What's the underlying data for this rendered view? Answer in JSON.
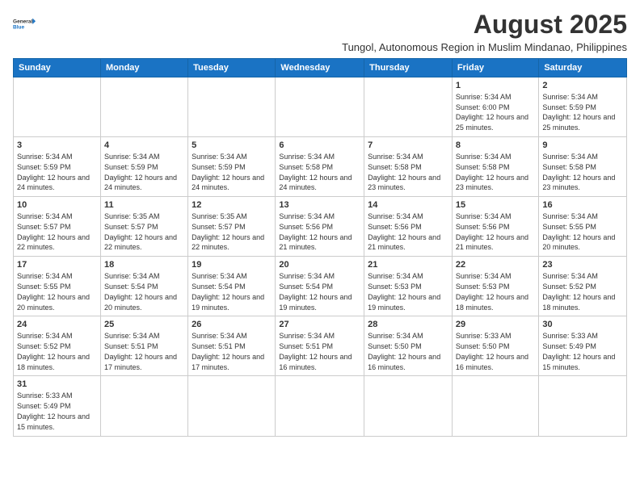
{
  "header": {
    "logo_general": "General",
    "logo_blue": "Blue",
    "main_title": "August 2025",
    "subtitle": "Tungol, Autonomous Region in Muslim Mindanao, Philippines"
  },
  "days_of_week": [
    "Sunday",
    "Monday",
    "Tuesday",
    "Wednesday",
    "Thursday",
    "Friday",
    "Saturday"
  ],
  "weeks": [
    [
      {
        "day": "",
        "info": ""
      },
      {
        "day": "",
        "info": ""
      },
      {
        "day": "",
        "info": ""
      },
      {
        "day": "",
        "info": ""
      },
      {
        "day": "",
        "info": ""
      },
      {
        "day": "1",
        "info": "Sunrise: 5:34 AM\nSunset: 6:00 PM\nDaylight: 12 hours and 25 minutes."
      },
      {
        "day": "2",
        "info": "Sunrise: 5:34 AM\nSunset: 5:59 PM\nDaylight: 12 hours and 25 minutes."
      }
    ],
    [
      {
        "day": "3",
        "info": "Sunrise: 5:34 AM\nSunset: 5:59 PM\nDaylight: 12 hours and 24 minutes."
      },
      {
        "day": "4",
        "info": "Sunrise: 5:34 AM\nSunset: 5:59 PM\nDaylight: 12 hours and 24 minutes."
      },
      {
        "day": "5",
        "info": "Sunrise: 5:34 AM\nSunset: 5:59 PM\nDaylight: 12 hours and 24 minutes."
      },
      {
        "day": "6",
        "info": "Sunrise: 5:34 AM\nSunset: 5:58 PM\nDaylight: 12 hours and 24 minutes."
      },
      {
        "day": "7",
        "info": "Sunrise: 5:34 AM\nSunset: 5:58 PM\nDaylight: 12 hours and 23 minutes."
      },
      {
        "day": "8",
        "info": "Sunrise: 5:34 AM\nSunset: 5:58 PM\nDaylight: 12 hours and 23 minutes."
      },
      {
        "day": "9",
        "info": "Sunrise: 5:34 AM\nSunset: 5:58 PM\nDaylight: 12 hours and 23 minutes."
      }
    ],
    [
      {
        "day": "10",
        "info": "Sunrise: 5:34 AM\nSunset: 5:57 PM\nDaylight: 12 hours and 22 minutes."
      },
      {
        "day": "11",
        "info": "Sunrise: 5:35 AM\nSunset: 5:57 PM\nDaylight: 12 hours and 22 minutes."
      },
      {
        "day": "12",
        "info": "Sunrise: 5:35 AM\nSunset: 5:57 PM\nDaylight: 12 hours and 22 minutes."
      },
      {
        "day": "13",
        "info": "Sunrise: 5:34 AM\nSunset: 5:56 PM\nDaylight: 12 hours and 21 minutes."
      },
      {
        "day": "14",
        "info": "Sunrise: 5:34 AM\nSunset: 5:56 PM\nDaylight: 12 hours and 21 minutes."
      },
      {
        "day": "15",
        "info": "Sunrise: 5:34 AM\nSunset: 5:56 PM\nDaylight: 12 hours and 21 minutes."
      },
      {
        "day": "16",
        "info": "Sunrise: 5:34 AM\nSunset: 5:55 PM\nDaylight: 12 hours and 20 minutes."
      }
    ],
    [
      {
        "day": "17",
        "info": "Sunrise: 5:34 AM\nSunset: 5:55 PM\nDaylight: 12 hours and 20 minutes."
      },
      {
        "day": "18",
        "info": "Sunrise: 5:34 AM\nSunset: 5:54 PM\nDaylight: 12 hours and 20 minutes."
      },
      {
        "day": "19",
        "info": "Sunrise: 5:34 AM\nSunset: 5:54 PM\nDaylight: 12 hours and 19 minutes."
      },
      {
        "day": "20",
        "info": "Sunrise: 5:34 AM\nSunset: 5:54 PM\nDaylight: 12 hours and 19 minutes."
      },
      {
        "day": "21",
        "info": "Sunrise: 5:34 AM\nSunset: 5:53 PM\nDaylight: 12 hours and 19 minutes."
      },
      {
        "day": "22",
        "info": "Sunrise: 5:34 AM\nSunset: 5:53 PM\nDaylight: 12 hours and 18 minutes."
      },
      {
        "day": "23",
        "info": "Sunrise: 5:34 AM\nSunset: 5:52 PM\nDaylight: 12 hours and 18 minutes."
      }
    ],
    [
      {
        "day": "24",
        "info": "Sunrise: 5:34 AM\nSunset: 5:52 PM\nDaylight: 12 hours and 18 minutes."
      },
      {
        "day": "25",
        "info": "Sunrise: 5:34 AM\nSunset: 5:51 PM\nDaylight: 12 hours and 17 minutes."
      },
      {
        "day": "26",
        "info": "Sunrise: 5:34 AM\nSunset: 5:51 PM\nDaylight: 12 hours and 17 minutes."
      },
      {
        "day": "27",
        "info": "Sunrise: 5:34 AM\nSunset: 5:51 PM\nDaylight: 12 hours and 16 minutes."
      },
      {
        "day": "28",
        "info": "Sunrise: 5:34 AM\nSunset: 5:50 PM\nDaylight: 12 hours and 16 minutes."
      },
      {
        "day": "29",
        "info": "Sunrise: 5:33 AM\nSunset: 5:50 PM\nDaylight: 12 hours and 16 minutes."
      },
      {
        "day": "30",
        "info": "Sunrise: 5:33 AM\nSunset: 5:49 PM\nDaylight: 12 hours and 15 minutes."
      }
    ],
    [
      {
        "day": "31",
        "info": "Sunrise: 5:33 AM\nSunset: 5:49 PM\nDaylight: 12 hours and 15 minutes."
      },
      {
        "day": "",
        "info": ""
      },
      {
        "day": "",
        "info": ""
      },
      {
        "day": "",
        "info": ""
      },
      {
        "day": "",
        "info": ""
      },
      {
        "day": "",
        "info": ""
      },
      {
        "day": "",
        "info": ""
      }
    ]
  ]
}
